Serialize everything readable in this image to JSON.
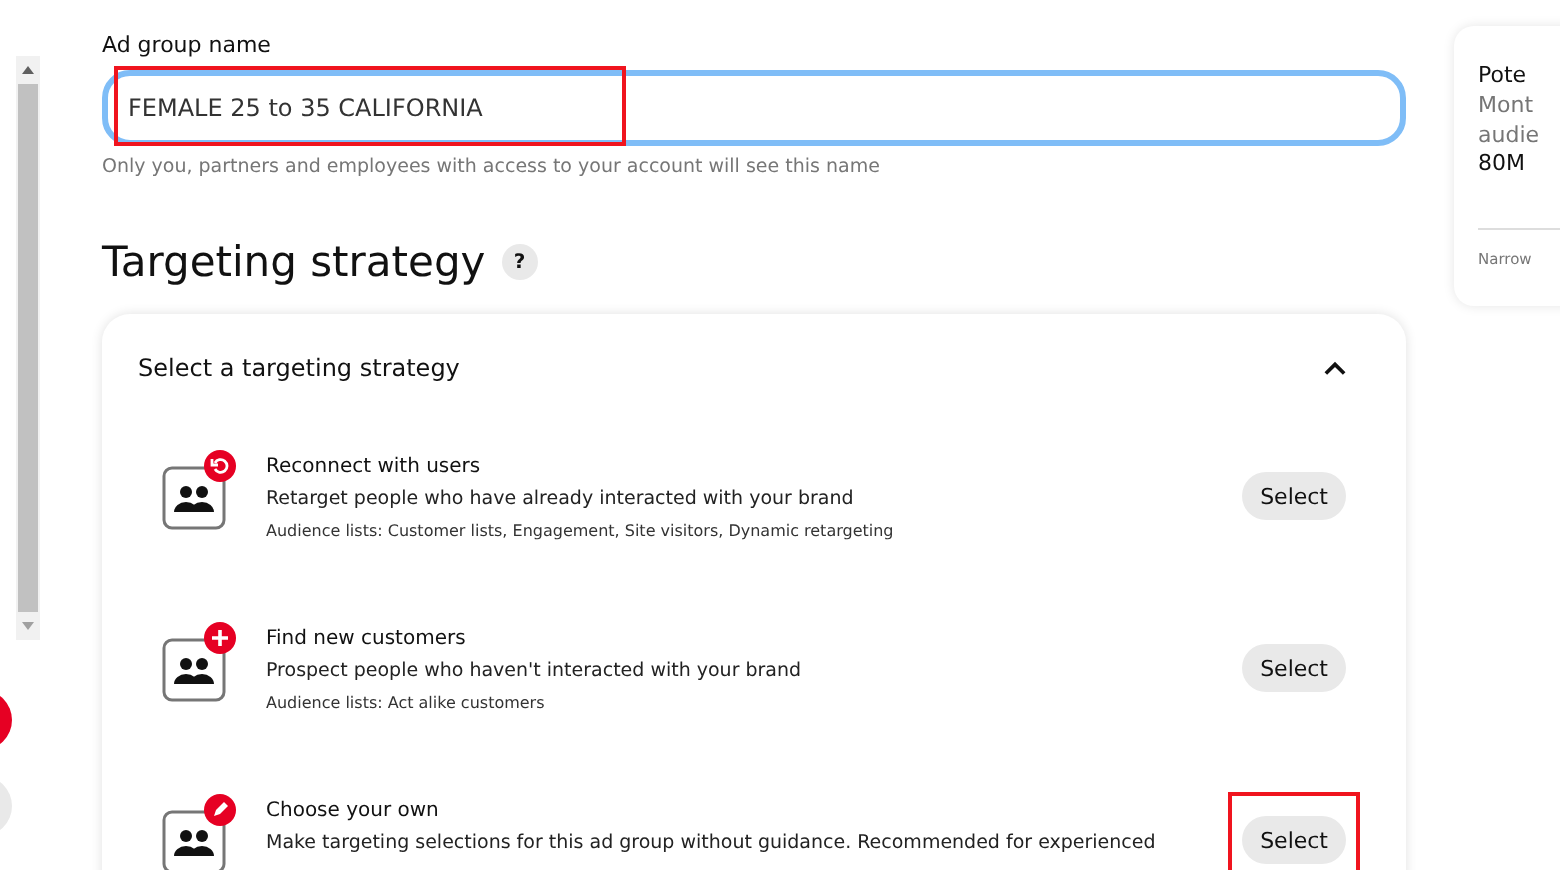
{
  "name_field": {
    "label": "Ad group name",
    "value": "FEMALE 25 to 35 CALIFORNIA",
    "hint": "Only you, partners and employees with access to your account will see this name",
    "highlighted": true
  },
  "section": {
    "title": "Targeting strategy",
    "help": "?"
  },
  "strategy_panel": {
    "title": "Select a targeting strategy",
    "expanded": true,
    "strategies": [
      {
        "kind": "retarget",
        "title": "Reconnect with users",
        "description": "Retarget people who have already interacted with your brand",
        "details": "Audience lists: Customer lists, Engagement, Site visitors, Dynamic retargeting",
        "button": "Select",
        "highlighted": false
      },
      {
        "kind": "prospect",
        "title": "Find new customers",
        "description": "Prospect people who haven't interacted with your brand",
        "details": "Audience lists: Act alike customers",
        "button": "Select",
        "highlighted": false
      },
      {
        "kind": "custom",
        "title": "Choose your own",
        "description": "Make targeting selections for this ad group without guidance. Recommended for experienced",
        "button": "Select",
        "highlighted": true
      }
    ]
  },
  "side_card": {
    "title": "Pote",
    "line_1": "Mont",
    "line_2": "audie",
    "value": "80M",
    "footer": "Narrow"
  }
}
